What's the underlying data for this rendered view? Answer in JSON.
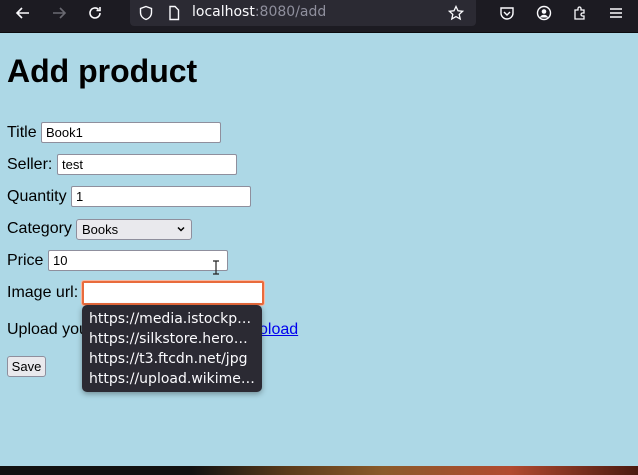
{
  "browser": {
    "url_host": "localhost",
    "url_path": ":8080/add"
  },
  "page": {
    "title": "Add product",
    "fields": {
      "title": {
        "label": "Title",
        "value": "Book1"
      },
      "seller": {
        "label": "Seller:",
        "value": "test"
      },
      "quantity": {
        "label": "Quantity",
        "value": "1"
      },
      "category": {
        "label": "Category",
        "value": "Books"
      },
      "price": {
        "label": "Price",
        "value": "10"
      },
      "image_url": {
        "label": "Image url:",
        "value": ""
      }
    },
    "upload": {
      "text": "Upload you",
      "link": "oload"
    },
    "save_label": "Save"
  },
  "autocomplete": [
    "https://media.istockphoto.com",
    "https://silkstore.herokuapp.com",
    "https://t3.ftcdn.net/jpg",
    "https://upload.wikimedia.org"
  ]
}
